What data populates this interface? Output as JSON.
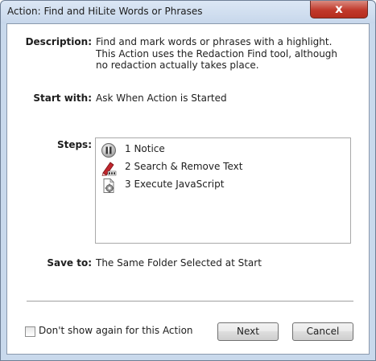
{
  "window": {
    "title": "Action: Find and HiLite Words or Phrases",
    "close_glyph": "x"
  },
  "description": {
    "label": "Description:",
    "lines": [
      "Find and mark words or phrases with a highlight.",
      "This Action uses the Redaction Find tool, although",
      "no redaction actually takes place."
    ]
  },
  "start_with": {
    "label": "Start with:",
    "value": "Ask When Action is Started"
  },
  "steps": {
    "label": "Steps:",
    "items": [
      {
        "label": "1  Notice",
        "icon": "pause-notice-icon"
      },
      {
        "label": "2  Search & Remove Text",
        "icon": "redact-marker-icon"
      },
      {
        "label": "3  Execute JavaScript",
        "icon": "script-gear-icon"
      }
    ]
  },
  "save_to": {
    "label": "Save to:",
    "value": "The Same Folder Selected at Start"
  },
  "footer": {
    "dont_show_label": "Don't show again for this Action",
    "dont_show_checked": false,
    "next_label": "Next",
    "cancel_label": "Cancel"
  },
  "colors": {
    "frame": "#c9d9ec",
    "close_button": "#c1392b",
    "redact_marker": "#c0262d"
  }
}
